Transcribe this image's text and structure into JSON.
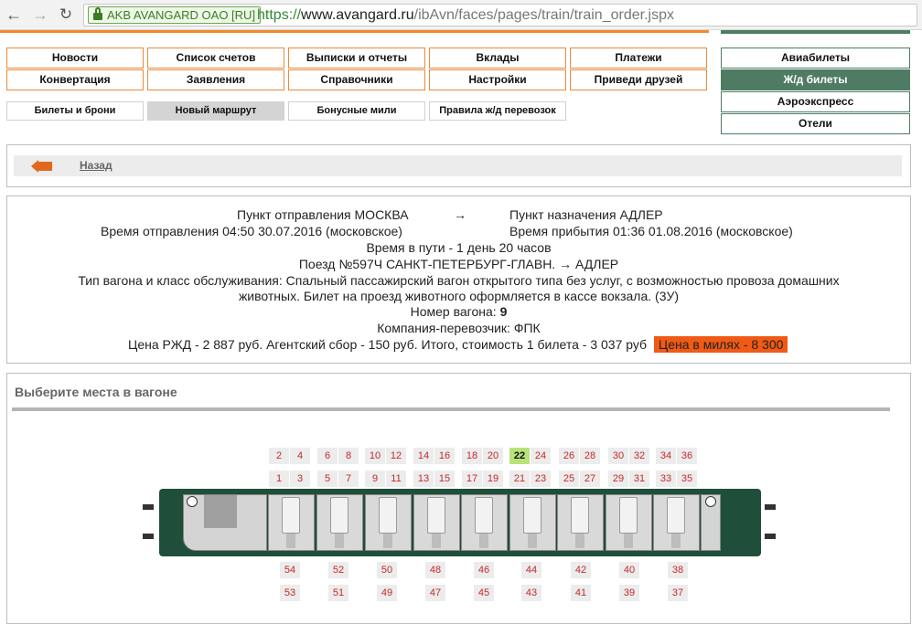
{
  "browser": {
    "cert_label": "AKB AVANGARD OAO [RU]",
    "url_scheme": "https://",
    "url_host": "www.avangard.ru",
    "url_path": "/ibAvn/faces/pages/train/train_order.jspx"
  },
  "menu": {
    "row1": [
      "Новости",
      "Список счетов",
      "Выписки и отчеты",
      "Вклады",
      "Платежи"
    ],
    "row2": [
      "Конвертация",
      "Заявления",
      "Справочники",
      "Настройки",
      "Приведи друзей"
    ],
    "sub": [
      "Билеты и брони",
      "Новый маршрут",
      "Бонусные мили",
      "Правила ж/д перевозок"
    ],
    "side": [
      "Авиабилеты",
      "Ж/д билеты",
      "Аэроэкспресс",
      "Отели"
    ]
  },
  "back_label": "Назад",
  "info": {
    "departure_point": "Пункт отправления МОСКВА",
    "arrow": "→",
    "arrival_point": "Пункт назначения АДЛЕР",
    "departure_time": "Время отправления 04:50 30.07.2016 (московское)",
    "arrival_time": "Время прибытия 01:36 01.08.2016 (московское)",
    "travel_time": "Время в пути - 1 день 20 часов",
    "train": "Поезд №597Ч  САНКТ-ПЕТЕРБУРГ-ГЛАВН.  →  АДЛЕР",
    "car_type_1": "Тип вагона и класс обслуживания: Спальный пассажирский вагон открытого типа без услуг, с возможностью провоза домашних",
    "car_type_2": "животных. Билет на проезд животного оформляется в кассе вокзала. (3У)",
    "car_number_label": "Номер вагона: ",
    "car_number": "9",
    "carrier": "Компания-перевозчик: ФПК",
    "price": "Цена РЖД - 2 887 руб. Агентский сбор - 150 руб. Итого, стоимость 1 билета - 3 037 руб",
    "miles": "Цена в милях - 8 300"
  },
  "seats_title": "Выберите места в вагоне",
  "seats": {
    "top_upper": [
      "2",
      "4",
      "6",
      "8",
      "10",
      "12",
      "14",
      "16",
      "18",
      "20",
      "22",
      "24",
      "26",
      "28",
      "30",
      "32",
      "34",
      "36"
    ],
    "top_lower": [
      "1",
      "3",
      "5",
      "7",
      "9",
      "11",
      "13",
      "15",
      "17",
      "19",
      "21",
      "23",
      "25",
      "27",
      "29",
      "31",
      "33",
      "35"
    ],
    "side_upper": [
      "54",
      "52",
      "50",
      "48",
      "46",
      "44",
      "42",
      "40",
      "38"
    ],
    "side_lower": [
      "53",
      "51",
      "49",
      "47",
      "45",
      "43",
      "41",
      "39",
      "37"
    ],
    "selected": "22"
  },
  "colors": {
    "orange": "#e88b3c",
    "green": "#4f7a63",
    "miles_bg": "#f05a14",
    "selected_seat": "#b8e27a",
    "seat_text": "#c62828"
  }
}
